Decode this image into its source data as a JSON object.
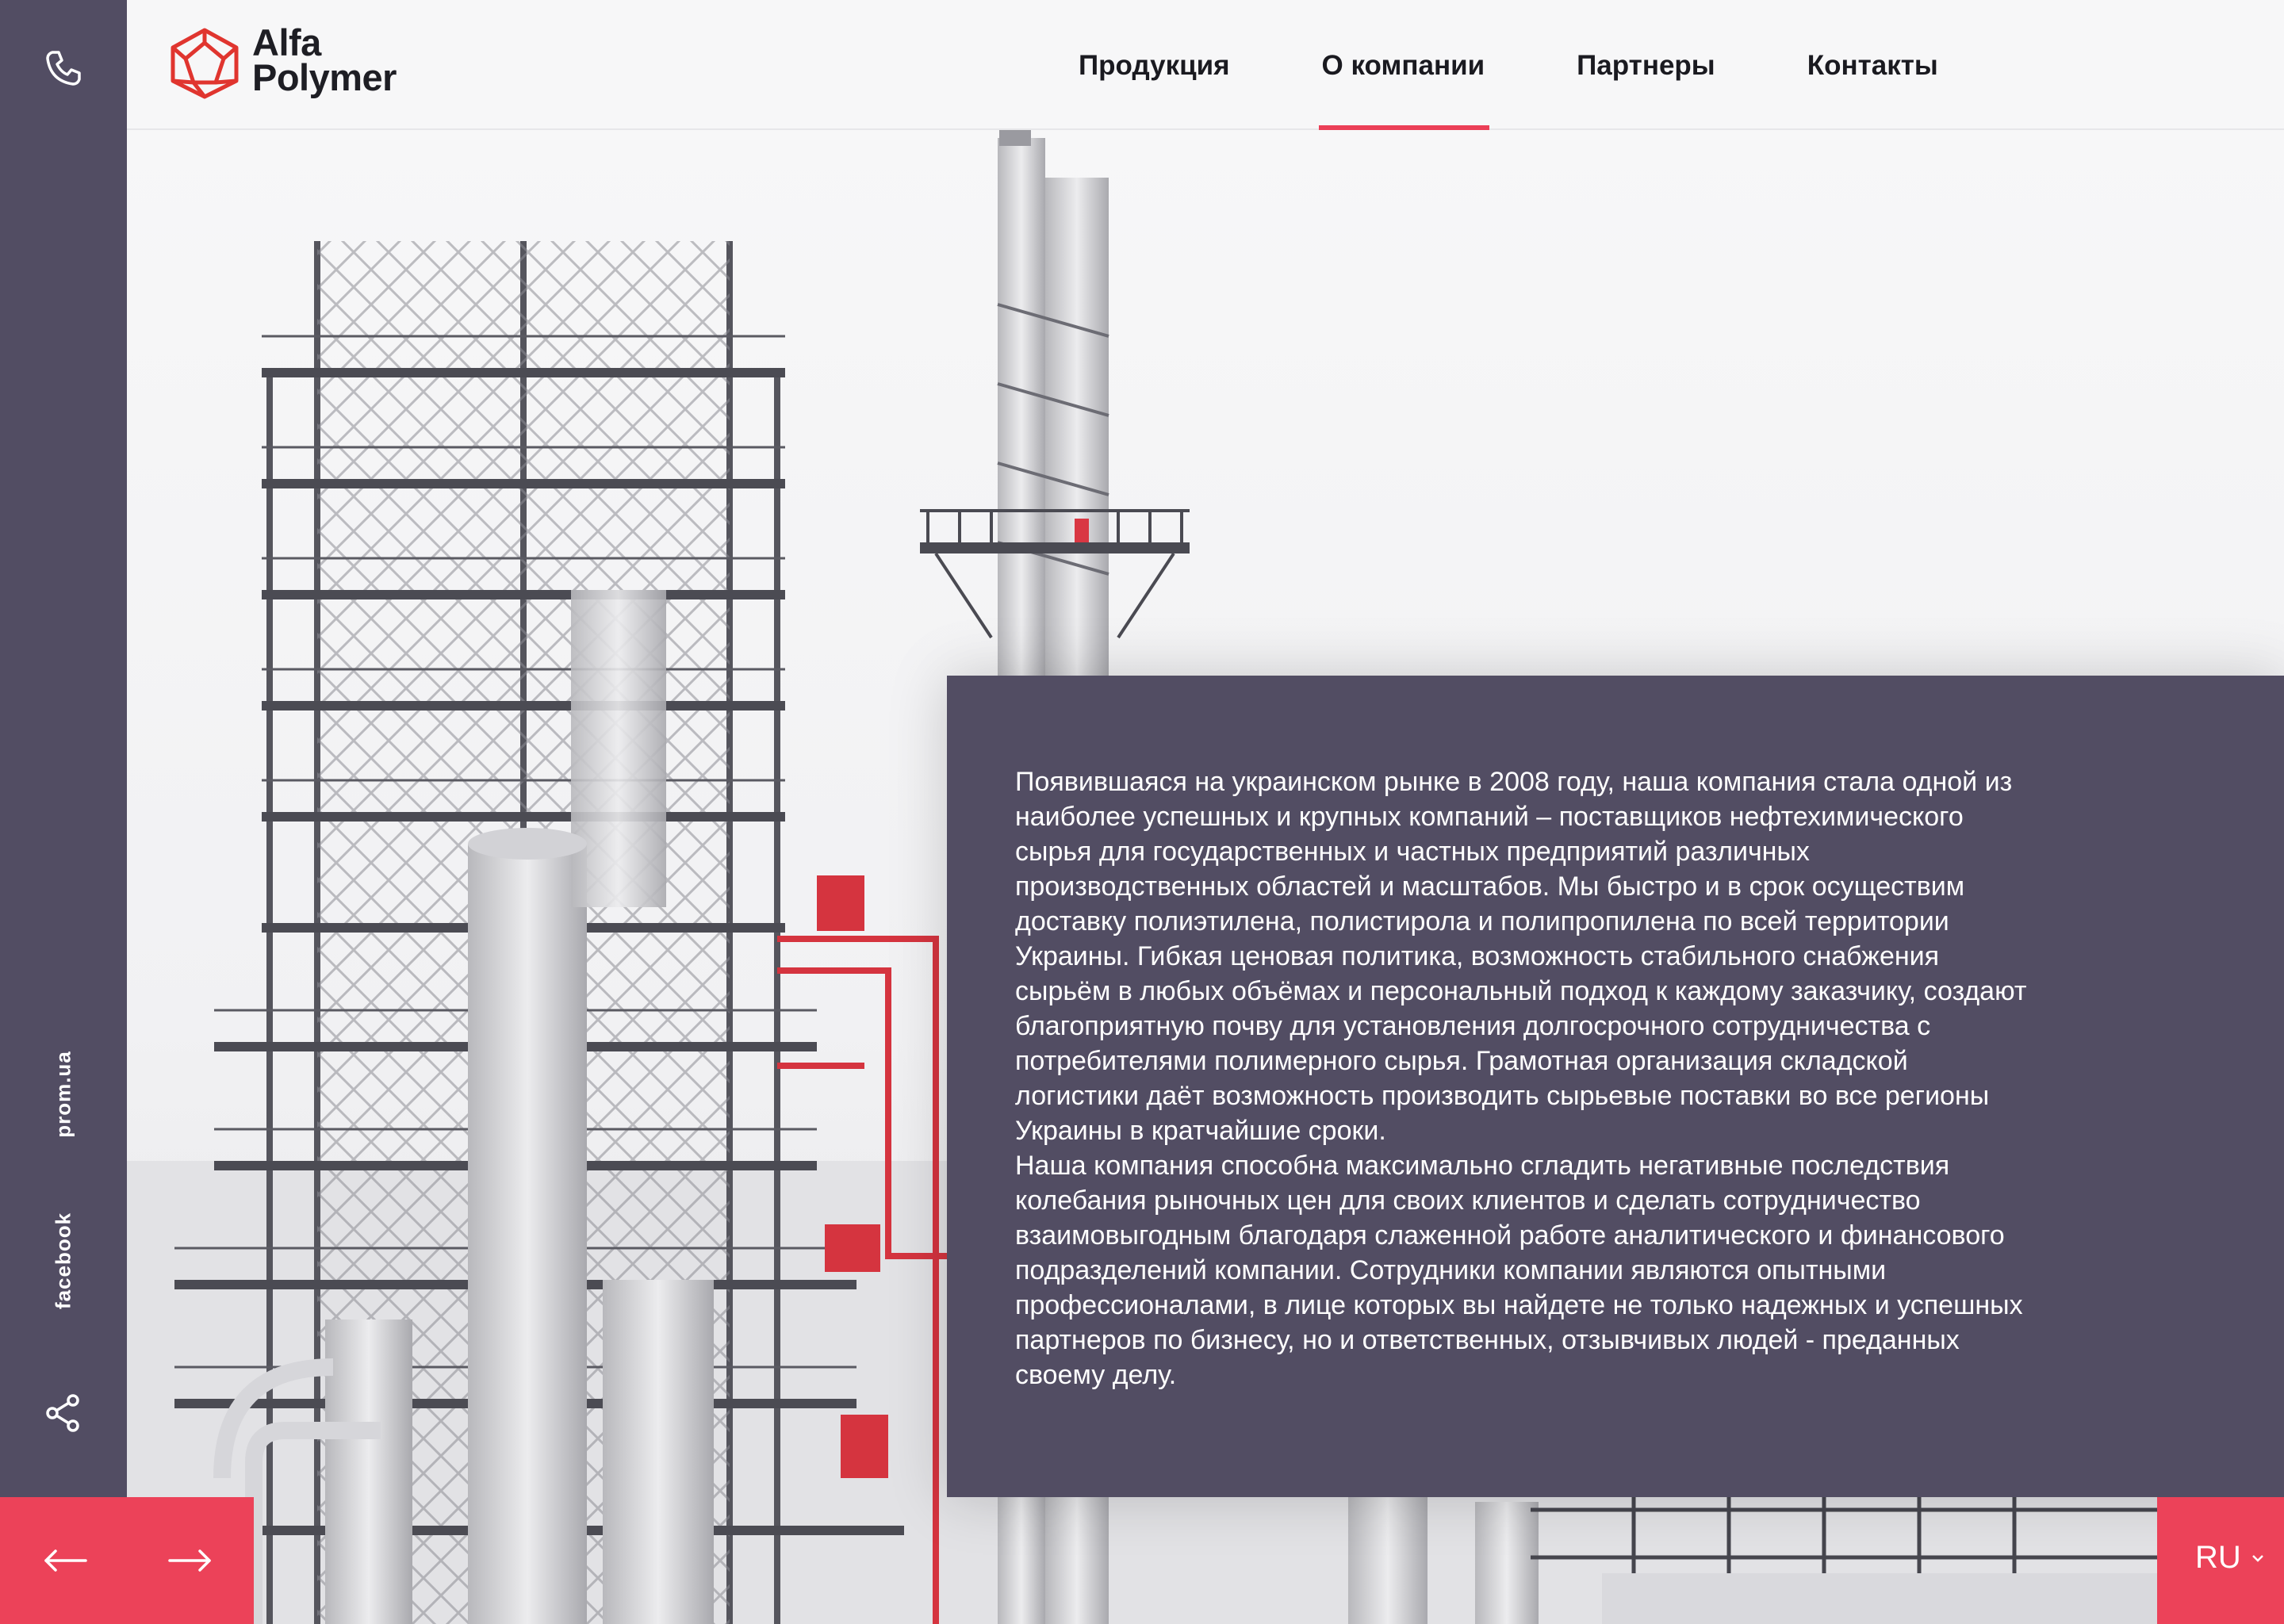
{
  "brand": {
    "name_line1": "Alfa",
    "name_line2": "Polymer",
    "accent_color": "#eb3f57",
    "panel_color": "#524d63"
  },
  "nav": {
    "items": [
      {
        "label": "Продукция",
        "active": false
      },
      {
        "label": "О компании",
        "active": true
      },
      {
        "label": "Партнеры",
        "active": false
      },
      {
        "label": "Контакты",
        "active": false
      }
    ]
  },
  "sidebar": {
    "phone_icon": "phone-icon",
    "links": [
      {
        "label": "prom.ua"
      },
      {
        "label": "facebook"
      }
    ],
    "share_icon": "share-icon"
  },
  "about": {
    "paragraph1": "Появившаяся на украинском рынке в 2008 году, наша компания стала одной из наиболее успешных и крупных компаний – поставщиков нефтехимического сырья для государственных и частных предприятий различных производственных областей и масштабов. Мы быстро и в срок осуществим доставку полиэтилена, полистирола и полипропилена по всей территории Украины. Гибкая ценовая политика, возможность стабильного снабжения сырьём в любых объёмах и персональный подход к каждому заказчику, создают благоприятную почву для установления долгосрочного сотрудничества с потребителями полимерного сырья. Грамотная организация складской логистики даёт возможность производить сырьевые поставки во все регионы Украины в кратчайшие сроки.",
    "paragraph2": "Наша компания способна максимально сгладить негативные последствия колебания рыночных цен для своих клиентов и сделать сотрудничество взаимовыгодным благодаря слаженной работе аналитического и финансового подразделений компании. Сотрудники компании являются опытными профессионалами, в лице которых вы найдете не только надежных и успешных партнеров по бизнесу, но и ответственных, отзывчивых людей - преданных своему делу."
  },
  "controls": {
    "prev_icon": "arrow-left-icon",
    "next_icon": "arrow-right-icon",
    "language": "RU"
  }
}
